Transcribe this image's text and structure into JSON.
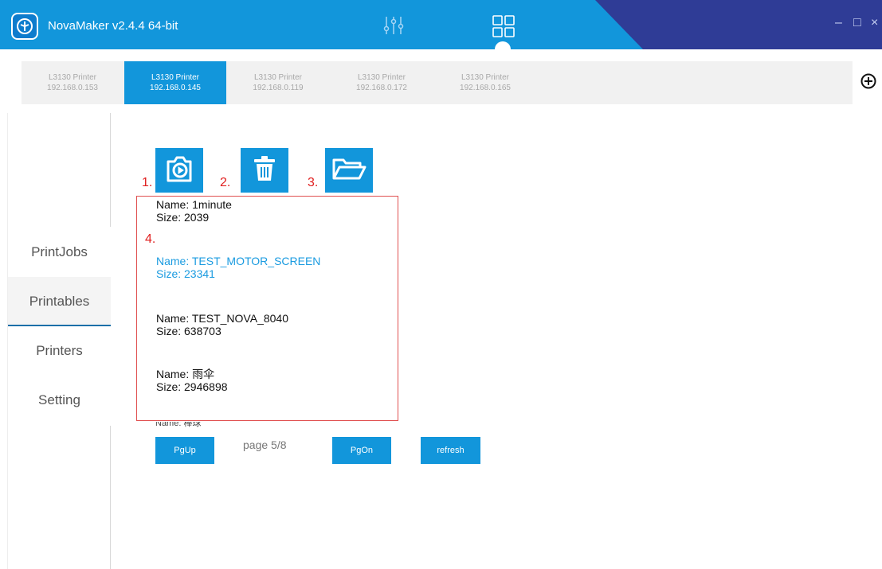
{
  "app": {
    "title": "NovaMaker v2.4.4 64-bit",
    "colors": {
      "primary": "#1296db",
      "title_dark": "#2f3c96",
      "callout": "#e02020",
      "selected_text": "#1a9be0"
    }
  },
  "header": {
    "icons": [
      "sliders-icon",
      "grid-icon"
    ],
    "window_controls": {
      "minimize": "–",
      "maximize": "□",
      "close": "×"
    }
  },
  "printers": {
    "tabs": [
      {
        "name": "L3130 Printer",
        "ip": "192.168.0.153",
        "active": false
      },
      {
        "name": "L3130 Printer",
        "ip": "192.168.0.145",
        "active": true
      },
      {
        "name": "L3130 Printer",
        "ip": "192.168.0.119",
        "active": false
      },
      {
        "name": "L3130 Printer",
        "ip": "192.168.0.172",
        "active": false
      },
      {
        "name": "L3130 Printer",
        "ip": "192.168.0.165",
        "active": false
      }
    ],
    "add_icon": "plus-circle-icon"
  },
  "sidebar": {
    "items": [
      {
        "label": "PrintJobs"
      },
      {
        "label": "Printables",
        "active": true
      },
      {
        "label": "Printers"
      },
      {
        "label": "Setting"
      }
    ]
  },
  "toolbar": {
    "buttons": [
      {
        "icon": "camera-play-icon",
        "callout": "1."
      },
      {
        "icon": "trash-icon",
        "callout": "2."
      },
      {
        "icon": "folder-open-icon",
        "callout": "3."
      }
    ]
  },
  "file_list": {
    "callout": "4.",
    "items": [
      {
        "name": "Name: 1minute",
        "size": "Size: 2039"
      },
      {
        "name": "Name: TEST_MOTOR_SCREEN",
        "size": "Size: 23341",
        "selected": true
      },
      {
        "name": "Name: TEST_NOVA_8040",
        "size": "Size: 638703"
      },
      {
        "name": "Name: 雨伞",
        "size": "Size: 2946898"
      },
      {
        "name": "Name: 棒球",
        "size": ""
      }
    ]
  },
  "pager": {
    "prev_label": "PgUp",
    "page_text": "page 5/8",
    "next_label": "PgOn",
    "refresh_label": "refresh"
  }
}
